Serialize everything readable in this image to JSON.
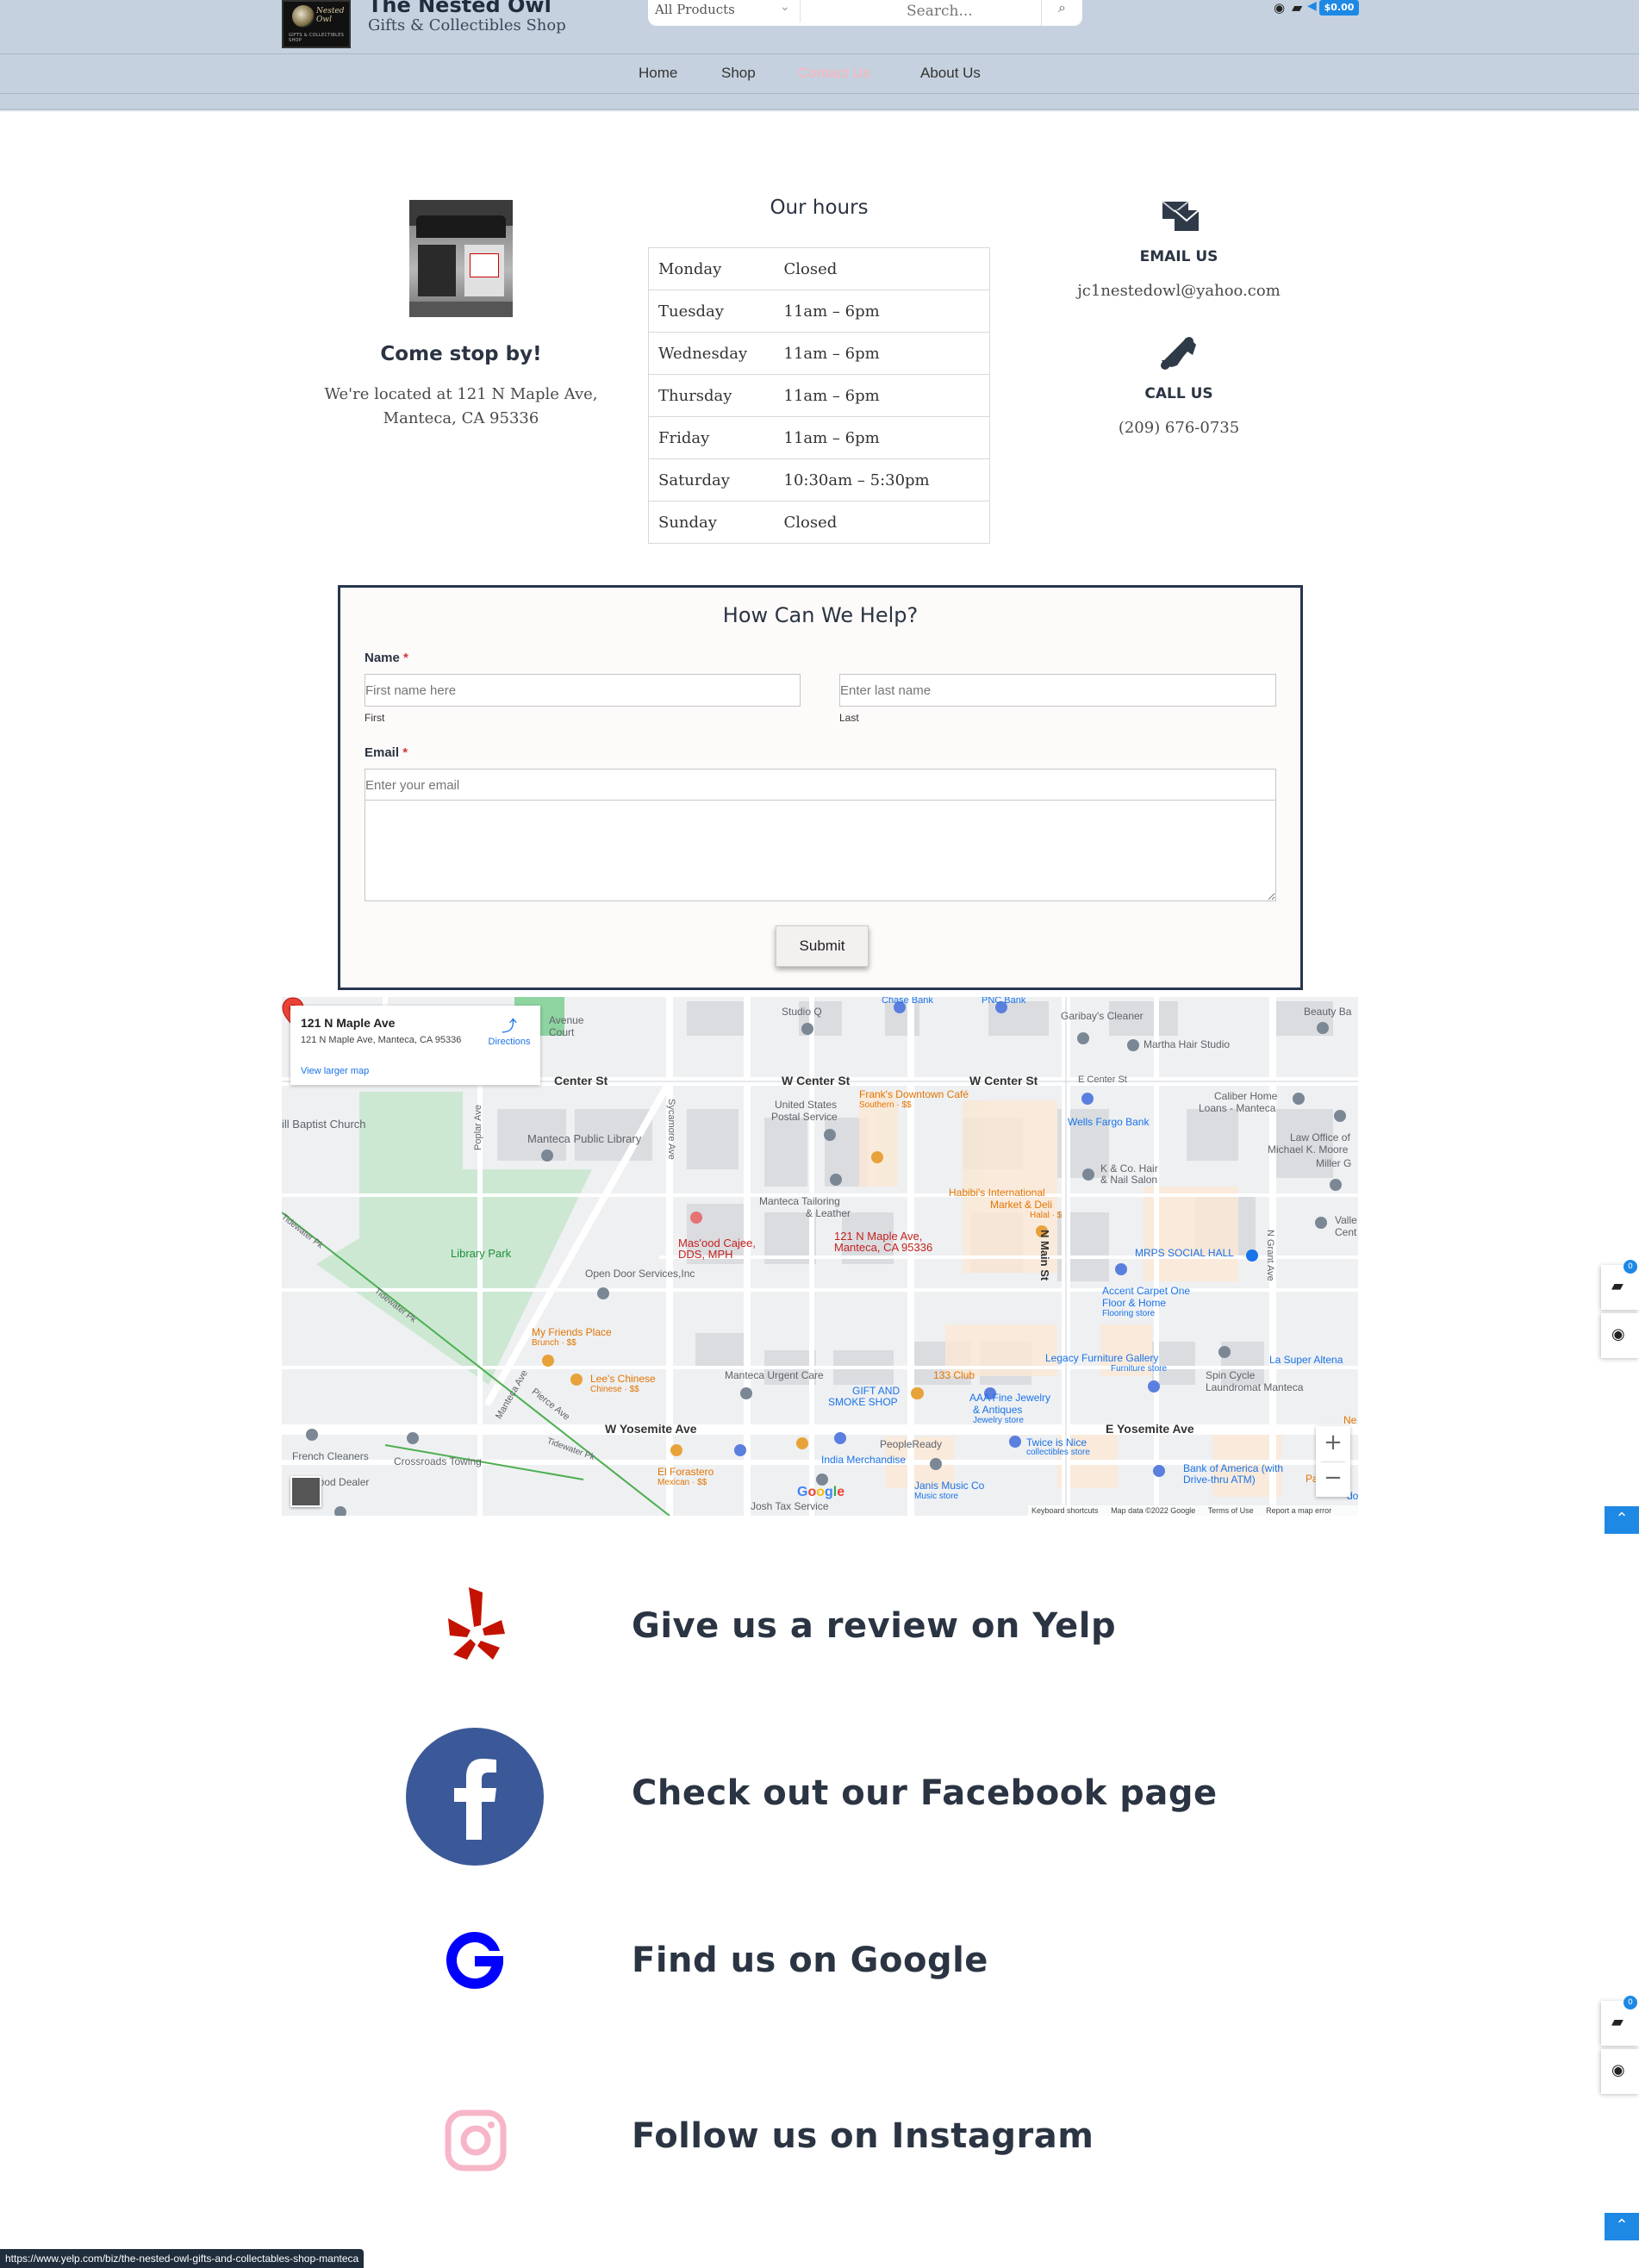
{
  "header": {
    "site_title": "The Nested Owl",
    "site_subtitle": "Gifts & Collectibles Shop",
    "logo_text": "Nested Owl",
    "logo_tagline": "GIFTS & COLLECTIBLES SHOP",
    "search": {
      "category": "All Products",
      "placeholder": "Search..."
    },
    "cart_total": "$0.00",
    "nav": [
      {
        "label": "Home"
      },
      {
        "label": "Shop"
      },
      {
        "label": "Contact Us",
        "active": true
      },
      {
        "label": "About Us"
      }
    ]
  },
  "visit": {
    "title": "Come stop by!",
    "text": "We're located at 121 N Maple Ave, Manteca, CA 95336"
  },
  "hours": {
    "title": "Our hours",
    "rows": [
      {
        "day": "Monday",
        "time": "Closed"
      },
      {
        "day": "Tuesday",
        "time": "11am – 6pm"
      },
      {
        "day": "Wednesday",
        "time": "11am – 6pm"
      },
      {
        "day": "Thursday",
        "time": "11am – 6pm"
      },
      {
        "day": "Friday",
        "time": "11am – 6pm"
      },
      {
        "day": "Saturday",
        "time": "10:30am – 5:30pm"
      },
      {
        "day": "Sunday",
        "time": "Closed"
      }
    ]
  },
  "contact": {
    "email_label": "EMAIL US",
    "email": "jc1nestedowl@yahoo.com",
    "call_label": "CALL US",
    "phone": "(209) 676-0735"
  },
  "form": {
    "title": "How Can We Help?",
    "name_label": "Name",
    "required_mark": "*",
    "first_placeholder": "First name here",
    "first_sub": "First",
    "last_placeholder": "Enter last name",
    "last_sub": "Last",
    "email_label": "Email",
    "email_placeholder": "Enter your email",
    "submit_label": "Submit"
  },
  "map": {
    "card_title": "121 N Maple Ave",
    "card_address": "121 N Maple Ave, Manteca, CA 95336",
    "directions_label": "Directions",
    "larger_map_label": "View larger map",
    "pin_label_line1": "121 N Maple Ave,",
    "pin_label_line2": "Manteca, CA 95336",
    "zoom_in": "+",
    "zoom_out": "−",
    "footer": [
      "Keyboard shortcuts",
      "Map data ©2022 Google",
      "Terms of Use",
      "Report a map error"
    ],
    "labels": {
      "center_st_w": "Center St",
      "w_center_st_1": "W Center St",
      "w_center_st_2": "W Center St",
      "e_center_st": "E Center St",
      "w_yosemite": "W Yosemite Ave",
      "e_yosemite": "E Yosemite Ave",
      "n_main": "N Main St",
      "n_grant": "N Grant Ave",
      "sycamore": "Sycamore Ave",
      "poplar": "Poplar Ave",
      "manteca_ave": "Manteca Ave",
      "pierce": "Pierce Ave",
      "tidewater1": "Tidewater Pk",
      "tidewater2": "Tidewater Pk",
      "tidewater3": "Tidewater Pk",
      "library_park": "Library Park",
      "library": "Manteca Public Library",
      "church": "ill Baptist Church",
      "usps1": "United States",
      "usps2": "Postal Service",
      "studioq": "Studio Q",
      "garibay": "Garibay's Cleaner",
      "martha": "Martha Hair Studio",
      "franks1": "Frank's Downtown Café",
      "franks2": "Southern · $$",
      "wells": "Wells Fargo Bank",
      "caliber1": "Caliber Home",
      "caliber2": "Loans - Manteca",
      "lawoffice1": "Law Office of",
      "lawoffice2": "Michael K. Moore",
      "millerg": "Miller G",
      "kco1": "K & Co. Hair",
      "kco2": "& Nail Salon",
      "tailoring1": "Manteca Tailoring",
      "tailoring2": "& Leather",
      "habibi1": "Habibi's International",
      "habibi2": "Market & Deli",
      "habibi3": "Halal · $",
      "masood1": "Mas'ood Cajee,",
      "masood2": "DDS, MPH",
      "mrps": "MRPS SOCIAL HALL",
      "valle": "Valle",
      "cent": "Cent",
      "opendoor": "Open Door Services,Inc",
      "accent1": "Accent Carpet One",
      "accent2": "Floor & Home",
      "accent3": "Flooring store",
      "myfriends1": "My Friends Place",
      "myfriends2": "Brunch · $$",
      "legacy1": "Legacy Furniture Gallery",
      "legacy2": "Furniture store",
      "spin1": "Spin Cycle",
      "spin2": "Laundromat Manteca",
      "laberaltena": "La Super Altena",
      "lees1": "Lee's Chinese",
      "lees2": "Chinese · $$",
      "urgent": "Manteca Urgent Care",
      "club133": "133 Club",
      "giftsmoke1": "GIFT AND",
      "giftsmoke2": "SMOKE SHOP",
      "aaa1": "AAA Fine Jewelry",
      "aaa2": "& Antiques",
      "aaa3": "Jewelry store",
      "french": "French Cleaners",
      "crossroads": "Crossroads Towing",
      "peopleready": "PeopleReady",
      "twice1": "Twice is Nice",
      "twice2": "collectibles store",
      "boa1": "Bank of America (with",
      "boa2": "Drive-thru ATM)",
      "elforastero1": "El Forastero",
      "elforastero2": "Mexican · $$",
      "india": "India Merchandise",
      "janis1": "Janis Music Co",
      "janis2": "Music store",
      "joshtax": "Josh Tax Service",
      "hood": "hood Dealer",
      "avenue1": "Avenue",
      "avenue2": "Court",
      "chasebank": "Chase Bank",
      "pncbank": "PNC Bank",
      "beautybar": "Beauty Ba",
      "pa": "Pa",
      "ne": "Ne",
      "do": "do",
      "google_logo": "Google"
    }
  },
  "social": [
    {
      "label": "Give us a review on Yelp",
      "icon": "yelp-icon",
      "color": "#c41200"
    },
    {
      "label": "Check out our Facebook page",
      "icon": "facebook-icon",
      "color": "#3b5998"
    },
    {
      "label": "Find us on Google",
      "icon": "google-icon",
      "color": "#0000ff"
    },
    {
      "label": "Follow us on Instagram",
      "icon": "instagram-icon",
      "color": "#f7b6c8"
    }
  ],
  "side": {
    "cart_badge": "0",
    "cart_badge2": "0"
  },
  "status_url": "https://www.yelp.com/biz/the-nested-owl-gifts-and-collectables-shop-manteca",
  "colors": {
    "header_bg": "#c5d1de",
    "accent": "#1e88e5",
    "active_nav": "#ffb3ba",
    "form_border": "#27364d"
  }
}
